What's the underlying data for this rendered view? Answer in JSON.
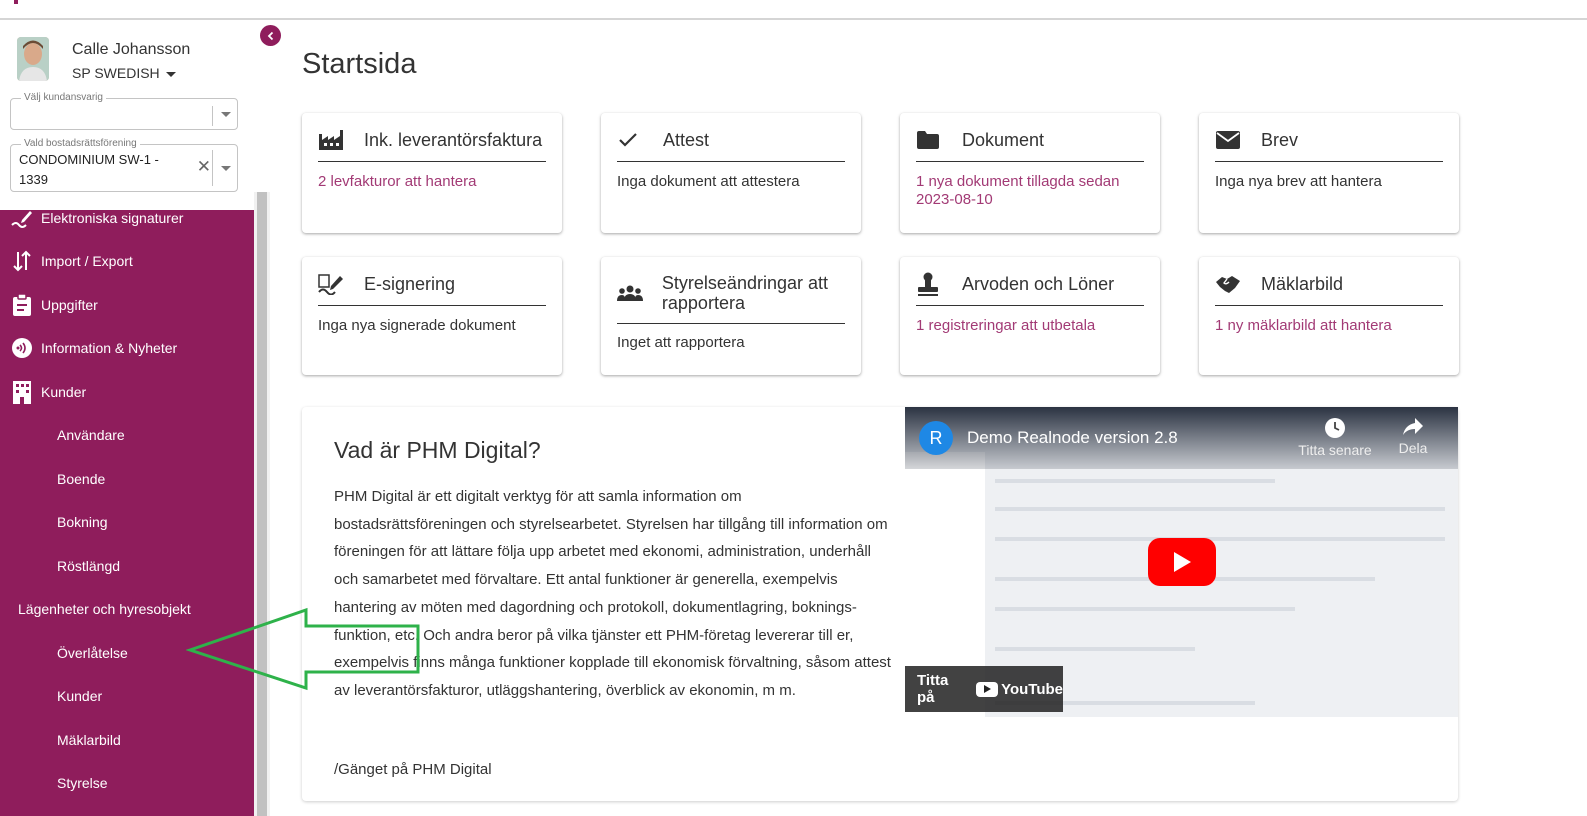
{
  "user": {
    "name": "Calle Johansson",
    "company": "SP SWEDISH"
  },
  "fields": {
    "customer_manager": {
      "label": "Välj kundansvarig",
      "value": ""
    },
    "association": {
      "label": "Vald bostadsrättsförening",
      "value": "CONDOMINIUM SW-1 - 1339"
    }
  },
  "nav": {
    "items": [
      {
        "label": "Elektroniska signaturer",
        "icon": "signature-icon"
      },
      {
        "label": "Import / Export",
        "icon": "import-export-icon"
      },
      {
        "label": "Uppgifter",
        "icon": "clipboard-icon"
      },
      {
        "label": "Information & Nyheter",
        "icon": "broadcast-icon"
      },
      {
        "label": "Kunder",
        "icon": "building-icon"
      }
    ],
    "sub_items": [
      {
        "label": "Användare"
      },
      {
        "label": "Boende"
      },
      {
        "label": "Bokning"
      },
      {
        "label": "Röstlängd"
      },
      {
        "label": "Lägenheter och hyresobjekt"
      },
      {
        "label": "Överlåtelse"
      },
      {
        "label": "Kunder"
      },
      {
        "label": "Mäklarbild"
      },
      {
        "label": "Styrelse"
      }
    ]
  },
  "page": {
    "title": "Startsida"
  },
  "cards": [
    {
      "title": "Ink. leverantörsfaktura",
      "icon": "factory-icon",
      "text": "2 levfakturor att hantera",
      "link": true
    },
    {
      "title": "Attest",
      "icon": "check-icon",
      "text": "Inga dokument att attestera",
      "link": false
    },
    {
      "title": "Dokument",
      "icon": "folder-icon",
      "text": "1 nya dokument tillagda sedan 2023-08-10",
      "link": true
    },
    {
      "title": "Brev",
      "icon": "envelope-icon",
      "text": "Inga nya brev att hantera",
      "link": false
    },
    {
      "title": "E-signering",
      "icon": "signature-icon",
      "text": "Inga nya signerade dokument",
      "link": false
    },
    {
      "title": "Styrelseändringar att rapportera",
      "icon": "group-icon",
      "text": "Inget att rapportera",
      "link": false
    },
    {
      "title": "Arvoden och Löner",
      "icon": "stamp-icon",
      "text": "1 registreringar att utbetala",
      "link": true
    },
    {
      "title": "Mäklarbild",
      "icon": "handshake-icon",
      "text": "1 ny mäklarbild att hantera",
      "link": true
    }
  ],
  "info": {
    "title": "Vad är PHM Digital?",
    "body": "PHM Digital är ett digitalt verktyg för att samla information om bostadsrättsföreningen och styrelsearbetet. Styrelsen har tillgång till information om föreningen för att lättare följa upp arbetet med ekonomi, administration, underhåll och samarbetet med förvaltare. Ett antal funktioner är generella, exempelvis hantering av möten med dagordning och protokoll, dokumentlagring, boknings-funktion, etc. Och andra beror på vilka tjänster ett PHM-företag levererar till er, exempelvis finns många funktioner kopplade till ekonomisk förvaltning, såsom attest av leverantörsfakturor, utläggshantering, överblick av ekonomin, m m.",
    "signature": "/Gänget på PHM Digital"
  },
  "video": {
    "channel_initial": "R",
    "title": "Demo Realnode version 2.8",
    "watch_later": "Titta senare",
    "share": "Dela",
    "watch_on": "Titta på",
    "youtube": "YouTube"
  },
  "colors": {
    "brand": "#8f1d5c",
    "link": "#a23a75",
    "annotation_arrow": "#2eb24a"
  }
}
